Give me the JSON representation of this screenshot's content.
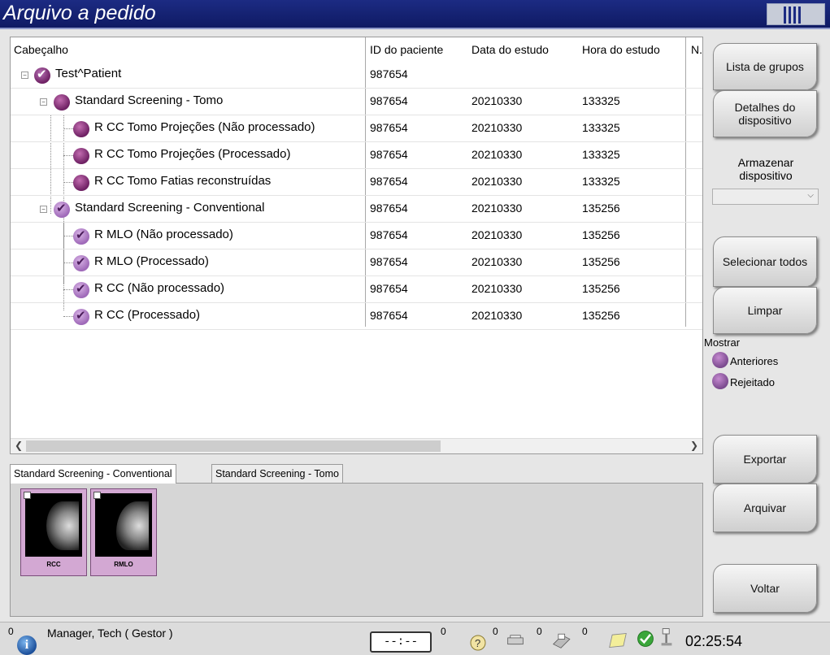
{
  "window": {
    "title": "Arquivo a pedido"
  },
  "table": {
    "headers": [
      "Cabeçalho",
      "ID do paciente",
      "Data do estudo",
      "Hora do estudo",
      "N."
    ],
    "rows": [
      {
        "name": "Test^Patient",
        "id": "987654",
        "date": "",
        "time": ""
      },
      {
        "name": "Standard Screening - Tomo",
        "id": "987654",
        "date": "20210330",
        "time": "133325"
      },
      {
        "name": "R CC Tomo  Projeções (Não processado)",
        "id": "987654",
        "date": "20210330",
        "time": "133325"
      },
      {
        "name": "R CC Tomo  Projeções (Processado)",
        "id": "987654",
        "date": "20210330",
        "time": "133325"
      },
      {
        "name": "R CC Tomo  Fatias reconstruídas",
        "id": "987654",
        "date": "20210330",
        "time": "133325"
      },
      {
        "name": "Standard Screening - Conventional",
        "id": "987654",
        "date": "20210330",
        "time": "135256"
      },
      {
        "name": "R MLO   (Não processado)",
        "id": "987654",
        "date": "20210330",
        "time": "135256"
      },
      {
        "name": "R MLO   (Processado)",
        "id": "987654",
        "date": "20210330",
        "time": "135256"
      },
      {
        "name": "R CC   (Não processado)",
        "id": "987654",
        "date": "20210330",
        "time": "135256"
      },
      {
        "name": "R CC   (Processado)",
        "id": "987654",
        "date": "20210330",
        "time": "135256"
      }
    ]
  },
  "tabs": [
    "Standard Screening - Conventional",
    "Standard Screening - Tomo"
  ],
  "thumbnails": [
    {
      "label": "RCC"
    },
    {
      "label": "RMLO"
    }
  ],
  "right_panel": {
    "group_list": "Lista de grupos",
    "device_details": "Detalhes do dispositivo",
    "store_device_label": "Armazenar dispositivo",
    "store_device_value": "",
    "select_all": "Selecionar todos",
    "clear": "Limpar",
    "show_label": "Mostrar",
    "show_prior": "Anteriores",
    "show_rejected": "Rejeitado",
    "export": "Exportar",
    "archive": "Arquivar",
    "back": "Voltar"
  },
  "status_bar": {
    "left_count": "0",
    "user": "Manager, Tech ( Gestor )",
    "clock_display": "--:--",
    "counts": [
      "0",
      "0",
      "0",
      "0"
    ],
    "time": "02:25:54"
  },
  "icons": {
    "info": "info-icon",
    "help": "help-icon",
    "print_queue": "print-queue-icon",
    "printer": "printer-icon",
    "notes": "notes-icon",
    "status_ok": "checkmark-icon",
    "tube": "xray-tube-icon"
  }
}
